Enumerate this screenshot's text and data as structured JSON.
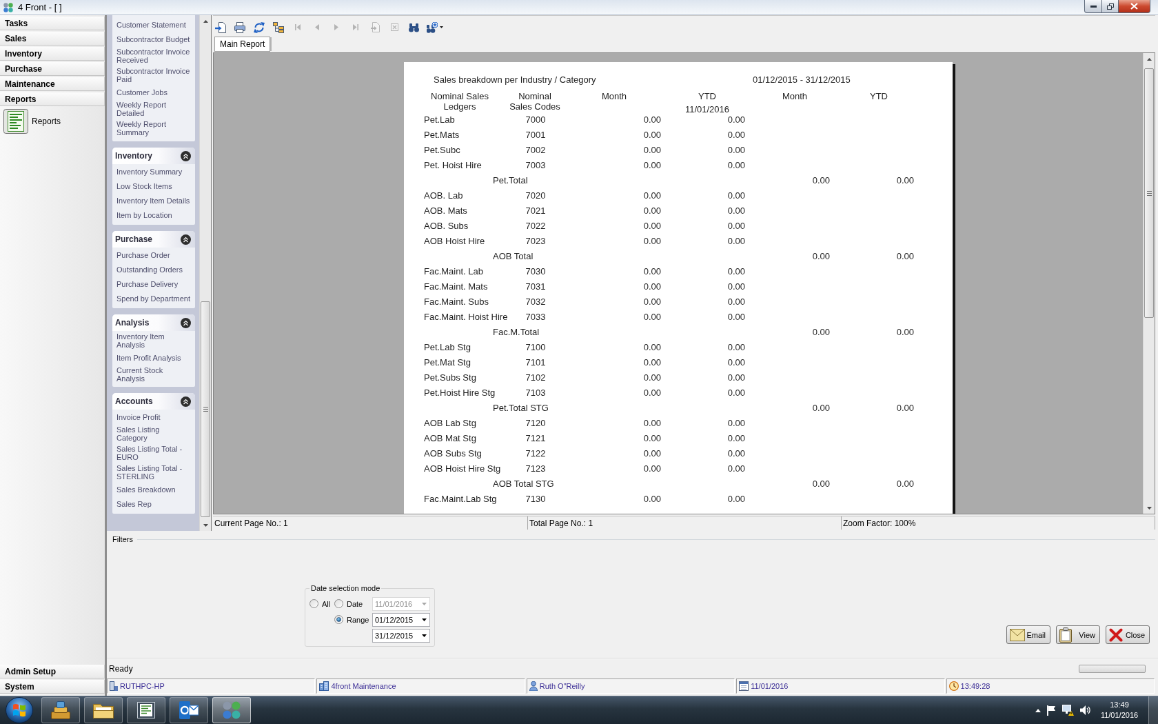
{
  "window": {
    "title": "4 Front - [ ]"
  },
  "nav": {
    "sections": [
      {
        "label": "Tasks"
      },
      {
        "label": "Sales"
      },
      {
        "label": "Inventory"
      },
      {
        "label": "Purchase"
      },
      {
        "label": "Maintenance"
      },
      {
        "label": "Reports",
        "items": [
          {
            "label": "Reports"
          }
        ]
      }
    ],
    "bottom_sections": [
      {
        "label": "Admin Setup"
      },
      {
        "label": "System"
      }
    ]
  },
  "sidebar": {
    "cut_group": {
      "items": [
        "Customer Statement",
        "Subcontractor Budget",
        "Subcontractor Invoice Received",
        "Subcontractor Invoice Paid",
        "Customer Jobs",
        "Weekly Report Detailed",
        "Weekly Report Summary"
      ]
    },
    "groups": [
      {
        "title": "Inventory",
        "expanded": true,
        "items": [
          "Inventory Summary",
          "Low Stock Items",
          "Inventory Item Details",
          "Item by Location"
        ]
      },
      {
        "title": "Purchase",
        "expanded": true,
        "items": [
          "Purchase Order",
          "Outstanding Orders",
          "Purchase Delivery",
          "Spend by Department"
        ]
      },
      {
        "title": "Analysis",
        "expanded": true,
        "items": [
          "Inventory Item Analysis",
          "Item Profit Analysis",
          "Current Stock Analysis"
        ]
      },
      {
        "title": "Accounts",
        "expanded": true,
        "items": [
          "Invoice Profit",
          "Sales Listing Category",
          "Sales Listing Total - EURO",
          "Sales Listing Total - STERLING",
          "Sales Breakdown",
          "Sales Rep"
        ]
      }
    ]
  },
  "toolbar": [
    {
      "kind": "export",
      "disabled": false
    },
    {
      "kind": "print",
      "disabled": false
    },
    {
      "kind": "refresh",
      "disabled": false
    },
    {
      "kind": "tree",
      "disabled": false
    },
    {
      "kind": "first",
      "disabled": true
    },
    {
      "kind": "previous",
      "disabled": true
    },
    {
      "kind": "next",
      "disabled": true
    },
    {
      "kind": "last",
      "disabled": true
    },
    {
      "kind": "goto",
      "disabled": true
    },
    {
      "kind": "stop",
      "disabled": true
    },
    {
      "kind": "search",
      "disabled": false
    },
    {
      "kind": "zoom",
      "disabled": false
    }
  ],
  "tabs": [
    {
      "label": "Main Report",
      "selected": true
    }
  ],
  "report": {
    "title": "Sales breakdown per Industry / Category",
    "period": "01/12/2015 - 31/12/2015",
    "columns": [
      {
        "label": "Nominal Sales Ledgers"
      },
      {
        "label": "Nominal Sales Codes"
      },
      {
        "label": "Month"
      },
      {
        "label": "YTD",
        "note": "11/01/2016"
      },
      {
        "label": "Month"
      },
      {
        "label": "YTD"
      }
    ],
    "rows": [
      {
        "kind": "line",
        "ledger": "Pet.Lab",
        "code": "7000",
        "month": "0.00",
        "ytd": "0.00"
      },
      {
        "kind": "line",
        "ledger": "Pet.Mats",
        "code": "7001",
        "month": "0.00",
        "ytd": "0.00"
      },
      {
        "kind": "line",
        "ledger": "Pet.Subc",
        "code": "7002",
        "month": "0.00",
        "ytd": "0.00"
      },
      {
        "kind": "line",
        "ledger": "Pet. Hoist Hire",
        "code": "7003",
        "month": "0.00",
        "ytd": "0.00"
      },
      {
        "kind": "total",
        "label": "Pet.Total",
        "month": "0.00",
        "ytd": "0.00"
      },
      {
        "kind": "line",
        "ledger": "AOB. Lab",
        "code": "7020",
        "month": "0.00",
        "ytd": "0.00"
      },
      {
        "kind": "line",
        "ledger": "AOB. Mats",
        "code": "7021",
        "month": "0.00",
        "ytd": "0.00"
      },
      {
        "kind": "line",
        "ledger": "AOB. Subs",
        "code": "7022",
        "month": "0.00",
        "ytd": "0.00"
      },
      {
        "kind": "line",
        "ledger": "AOB Hoist Hire",
        "code": "7023",
        "month": "0.00",
        "ytd": "0.00"
      },
      {
        "kind": "total",
        "label": "AOB Total",
        "month": "0.00",
        "ytd": "0.00"
      },
      {
        "kind": "line",
        "ledger": "Fac.Maint. Lab",
        "code": "7030",
        "month": "0.00",
        "ytd": "0.00"
      },
      {
        "kind": "line",
        "ledger": "Fac.Maint. Mats",
        "code": "7031",
        "month": "0.00",
        "ytd": "0.00"
      },
      {
        "kind": "line",
        "ledger": "Fac.Maint. Subs",
        "code": "7032",
        "month": "0.00",
        "ytd": "0.00"
      },
      {
        "kind": "line",
        "ledger": "Fac.Maint. Hoist Hire",
        "code": "7033",
        "month": "0.00",
        "ytd": "0.00"
      },
      {
        "kind": "total",
        "label": "Fac.M.Total",
        "month": "0.00",
        "ytd": "0.00"
      },
      {
        "kind": "line",
        "ledger": "Pet.Lab Stg",
        "code": "7100",
        "month": "0.00",
        "ytd": "0.00"
      },
      {
        "kind": "line",
        "ledger": "Pet.Mat Stg",
        "code": "7101",
        "month": "0.00",
        "ytd": "0.00"
      },
      {
        "kind": "line",
        "ledger": "Pet.Subs Stg",
        "code": "7102",
        "month": "0.00",
        "ytd": "0.00"
      },
      {
        "kind": "line",
        "ledger": "Pet.Hoist Hire Stg",
        "code": "7103",
        "month": "0.00",
        "ytd": "0.00"
      },
      {
        "kind": "total",
        "label": "Pet.Total STG",
        "month": "0.00",
        "ytd": "0.00"
      },
      {
        "kind": "line",
        "ledger": "AOB Lab Stg",
        "code": "7120",
        "month": "0.00",
        "ytd": "0.00"
      },
      {
        "kind": "line",
        "ledger": "AOB Mat Stg",
        "code": "7121",
        "month": "0.00",
        "ytd": "0.00"
      },
      {
        "kind": "line",
        "ledger": "AOB Subs Stg",
        "code": "7122",
        "month": "0.00",
        "ytd": "0.00"
      },
      {
        "kind": "line",
        "ledger": "AOB Hoist Hire Stg",
        "code": "7123",
        "month": "0.00",
        "ytd": "0.00"
      },
      {
        "kind": "total",
        "label": "AOB Total STG",
        "month": "0.00",
        "ytd": "0.00"
      },
      {
        "kind": "line",
        "ledger": "Fac.Maint.Lab Stg",
        "code": "7130",
        "month": "0.00",
        "ytd": "0.00"
      }
    ]
  },
  "page_status": [
    "Current Page No.: 1",
    "Total Page No.: 1",
    "Zoom Factor: 100%"
  ],
  "filters": {
    "title": "Filters",
    "date_mode": {
      "title": "Date selection mode",
      "options": [
        {
          "label": "All",
          "selected": false
        },
        {
          "label": "Date",
          "selected": false
        },
        {
          "label": "Range",
          "selected": true
        }
      ],
      "date": {
        "value": "11/01/2016",
        "disabled": true
      },
      "range_from": "01/12/2015",
      "range_to": "31/12/2015"
    }
  },
  "buttons": [
    {
      "kind": "email",
      "label": "Email"
    },
    {
      "kind": "view",
      "label": "View"
    },
    {
      "kind": "close",
      "label": "Close"
    }
  ],
  "status_bar": {
    "text": "Ready"
  },
  "info_bar": [
    {
      "kind": "computer",
      "text": "RUTHPC-HP"
    },
    {
      "kind": "building",
      "text": "4front Maintenance"
    },
    {
      "kind": "user",
      "text": "Ruth O\"Reilly"
    },
    {
      "kind": "date",
      "text": "11/01/2016"
    },
    {
      "kind": "time",
      "text": "13:49:28"
    }
  ],
  "taskbar": {
    "apps": [
      {
        "kind": "archive",
        "active": false
      },
      {
        "kind": "folder",
        "active": false
      },
      {
        "kind": "document",
        "active": false
      },
      {
        "kind": "mail",
        "active": false
      },
      {
        "kind": "app",
        "active": true
      }
    ],
    "clock": {
      "time": "13:49",
      "date": "11/01/2016"
    }
  }
}
